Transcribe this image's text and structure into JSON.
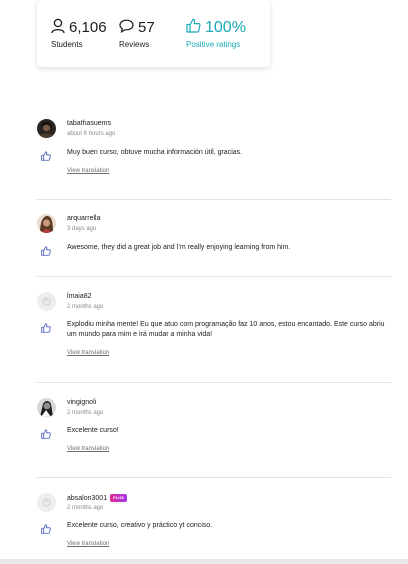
{
  "stats": {
    "students": {
      "value": "6,106",
      "label": "Students",
      "icon": "person-icon"
    },
    "reviews": {
      "value": "57",
      "label": "Reviews",
      "icon": "speech-bubble-icon"
    },
    "positive": {
      "value": "100%",
      "label": "Positive ratings",
      "icon": "thumbs-up-icon"
    }
  },
  "colors": {
    "accent": "#1ba9b7",
    "text": "#1c1d1f",
    "muted": "#8a8a8a"
  },
  "reviews": [
    {
      "author": "tabathasuems",
      "date": "about 6 hours ago",
      "text": "Muy buen curso, obtuve mucha información útil, gracias.",
      "translate": "View translation",
      "avatar": "photo"
    },
    {
      "author": "arquarrella",
      "date": "3 days ago",
      "text": "Awesome, they did a great job and I'm really enjoying learning from him.",
      "avatar": "photo"
    },
    {
      "author": "lmaia82",
      "date": "2 months ago",
      "text": "Explodiu minha mente! Eu que atuo com programação faz 10 anos, estou encantado. Este curso abriu um mundo para mim e irá mudar a minha vida!",
      "translate": "View translation",
      "avatar": "placeholder"
    },
    {
      "author": "vingignoli",
      "date": "2 months ago",
      "text": "Excelente curso!",
      "translate": "View translation",
      "avatar": "photo"
    },
    {
      "author": "absalon3001",
      "badge": "PLUS",
      "date": "2 months ago",
      "text": "Excelente curso, creativo y práctico yt conciso.",
      "translate": "View translation",
      "avatar": "placeholder"
    }
  ]
}
